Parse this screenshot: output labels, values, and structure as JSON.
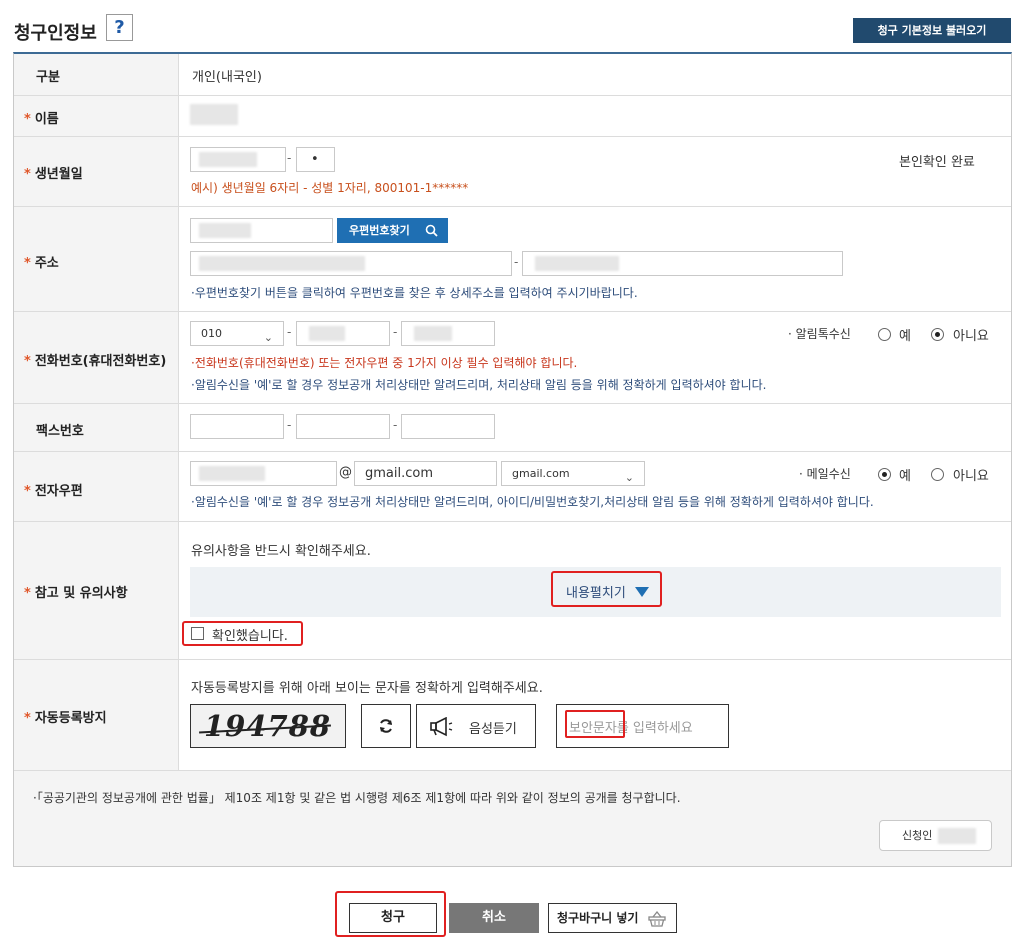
{
  "header": {
    "title": "청구인정보",
    "help_label": "?",
    "load_button": "청구 기본정보 불러오기"
  },
  "rows": {
    "type": {
      "label": "구분",
      "value": "개인(내국인)"
    },
    "name": {
      "label": "이름",
      "required": "*"
    },
    "birth": {
      "label": "생년월일",
      "required": "*",
      "second_value": "•",
      "status": "본인확인 완료",
      "example": "예시) 생년월일 6자리 - 성별 1자리, 800101-1******"
    },
    "address": {
      "label": "주소",
      "required": "*",
      "zip_button": "우편번호찾기",
      "note": "·우편번호찾기 버튼을 클릭하여 우편번호를 찾은 후 상세주소를 입력하여 주시기바랍니다."
    },
    "phone": {
      "label": "전화번호(휴대전화번호)",
      "required": "*",
      "prefix_selected": "010",
      "alert_label": "· 알림톡수신",
      "yes": "예",
      "no": "아니요",
      "alert_value": "아니요",
      "note_red": "·전화번호(휴대전화번호) 또는 전자우편 중 1가지 이상 필수 입력해야 합니다.",
      "note_blue": "·알림수신을 '예'로 할 경우 정보공개 처리상태만 알려드리며, 처리상태 알림 등을 위해 정확하게 입력하셔야 합니다."
    },
    "fax": {
      "label": "팩스번호"
    },
    "email": {
      "label": "전자우편",
      "required": "*",
      "at": "@",
      "domain_value": "gmail.com",
      "domain_selected": "gmail.com",
      "receive_label": "· 메일수신",
      "yes": "예",
      "no": "아니요",
      "receive_value": "예",
      "note": "·알림수신을 '예'로 할 경우 정보공개 처리상태만 알려드리며, 아이디/비밀번호찾기,처리상태 알림 등을 위해 정확하게 입력하셔야 합니다."
    },
    "notice": {
      "label": "참고 및 유의사항",
      "required": "*",
      "intro": "유의사항을 반드시 확인해주세요.",
      "expand_label": "내용펼치기",
      "confirm_label": "확인했습니다.",
      "confirmed": false
    },
    "captcha": {
      "label": "자동등록방지",
      "required": "*",
      "intro": "자동등록방지를 위해 아래 보이는 문자를 정확하게 입력해주세요.",
      "code": "194788",
      "audio_label": "음성듣기",
      "placeholder": "보안문자를 입력하세요"
    }
  },
  "footer": {
    "statement": "·「공공기관의 정보공개에 관한 법률」 제10조 제1항 및 같은 법 시행령 제6조 제1항에 따라 위와 같이 정보의 공개를 청구합니다.",
    "sign_label": "신청인"
  },
  "actions": {
    "submit": "청구",
    "cancel": "취소",
    "cart": "청구바구니 넣기"
  },
  "colors": {
    "accent": "#1f6fb3",
    "header_button": "#214a6e",
    "required": "#e0572a",
    "highlight": "#e02020"
  }
}
